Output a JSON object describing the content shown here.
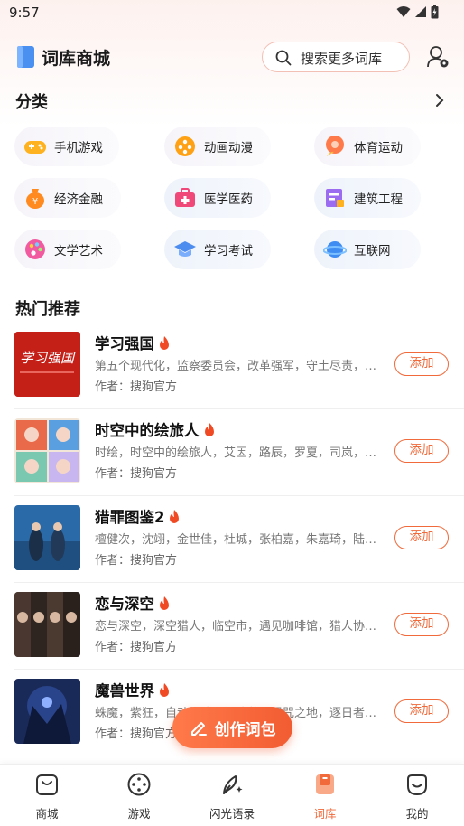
{
  "status_bar": {
    "time": "9:57"
  },
  "header": {
    "title": "词库商城",
    "search_placeholder": "搜索更多词库"
  },
  "categories": {
    "title": "分类",
    "items": [
      {
        "label": "手机游戏",
        "icon": "gamepad-icon"
      },
      {
        "label": "动画动漫",
        "icon": "anime-icon"
      },
      {
        "label": "体育运动",
        "icon": "sports-icon"
      },
      {
        "label": "经济金融",
        "icon": "money-bag-icon"
      },
      {
        "label": "医学医药",
        "icon": "medical-kit-icon"
      },
      {
        "label": "建筑工程",
        "icon": "construction-icon"
      },
      {
        "label": "文学艺术",
        "icon": "palette-icon"
      },
      {
        "label": "学习考试",
        "icon": "graduation-cap-icon"
      },
      {
        "label": "互联网",
        "icon": "planet-icon"
      }
    ]
  },
  "hot": {
    "title": "热门推荐",
    "add_label": "添加",
    "author_prefix": "作者：",
    "items": [
      {
        "title": "学习强国",
        "desc": "第五个现代化，监察委员会，改革强军，守土尽责，…",
        "author": "作者：搜狗官方",
        "thumb_text": "学习强国"
      },
      {
        "title": "时空中的绘旅人",
        "desc": "时绘，时空中的绘旅人，艾因，路辰，罗夏，司岚，…",
        "author": "作者：搜狗官方"
      },
      {
        "title": "猎罪图鉴2",
        "desc": "檀健次，沈翊，金世佳，杜城，张柏嘉，朱嘉琦，陆…",
        "author": "作者：搜狗官方"
      },
      {
        "title": "恋与深空",
        "desc": "恋与深空，深空猎人，临空市，遇见咖啡馆，猎人协…",
        "author": "作者：搜狗官方"
      },
      {
        "title": "魔兽世界",
        "desc": "蛛魔，紫狂，自动加速，祖达萨，诅咒之地，逐日者…",
        "author": "作者：搜狗官方"
      }
    ]
  },
  "fab": {
    "label": "创作词包"
  },
  "bottom_nav": {
    "items": [
      {
        "label": "商城",
        "active": false
      },
      {
        "label": "游戏",
        "active": false
      },
      {
        "label": "闪光语录",
        "active": false
      },
      {
        "label": "词库",
        "active": true
      },
      {
        "label": "我的",
        "active": false
      }
    ]
  },
  "colors": {
    "accent": "#f06a3b",
    "fab": "#f25c32"
  }
}
